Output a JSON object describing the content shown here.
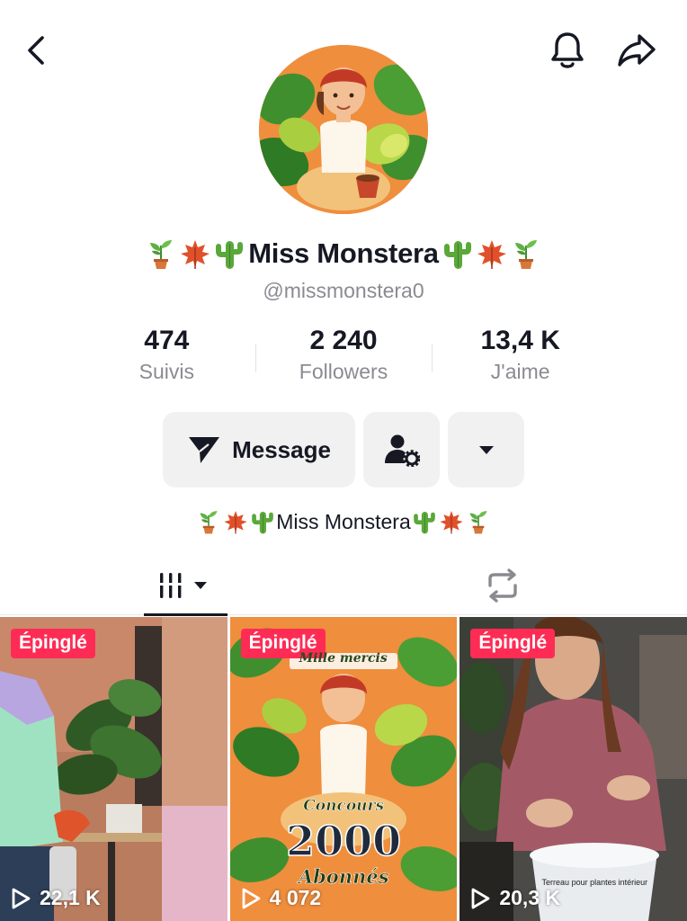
{
  "profile": {
    "display_name": "Miss Monstera",
    "handle": "@missmonstera0",
    "bio": "Miss Monstera"
  },
  "stats": [
    {
      "value": "474",
      "label": "Suivis"
    },
    {
      "value": "2 240",
      "label": "Followers"
    },
    {
      "value": "13,4 K",
      "label": "J'aime"
    }
  ],
  "actions": {
    "message_label": "Message"
  },
  "videos": [
    {
      "pinned_label": "Épinglé",
      "views": "22,1 K"
    },
    {
      "pinned_label": "Épinglé",
      "views": "4 072",
      "overlay_top": "Mille mercis",
      "overlay_contest": "Concours",
      "overlay_number": "2000",
      "overlay_subscribers": "Abonnés"
    },
    {
      "pinned_label": "Épinglé",
      "views": "20,3 K",
      "overlay_caption": "Terreau pour plantes intérieur"
    }
  ],
  "icons": [
    "back-icon",
    "bell-icon",
    "share-icon",
    "send-icon",
    "user-settings-icon",
    "caret-down-icon",
    "grid-icon",
    "repost-icon",
    "play-icon",
    "potted-plant-emoji",
    "maple-leaf-emoji",
    "cactus-emoji"
  ],
  "colors": {
    "pinned_badge": "#fe2c55",
    "text_primary": "#161823",
    "text_secondary": "#8a8b91",
    "button_bg": "#f1f1f2"
  }
}
